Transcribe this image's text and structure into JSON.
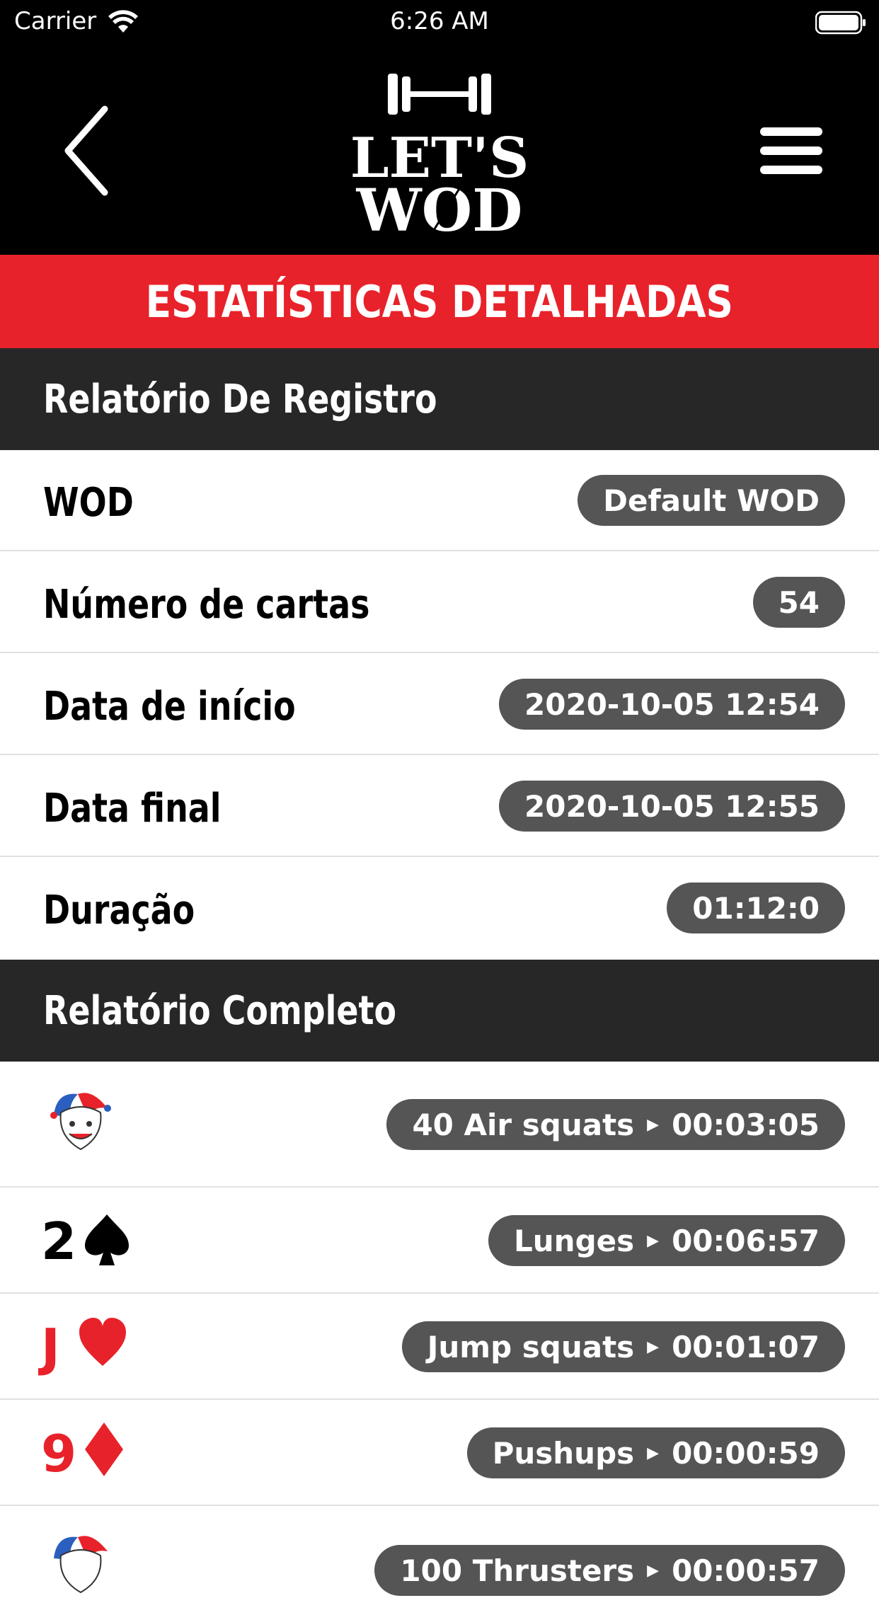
{
  "status_bar": {
    "carrier": "Carrier",
    "time": "6:26 AM"
  },
  "header": {
    "logo_line1": "LET'S",
    "logo_line2": "WOD"
  },
  "page_title": "ESTATÍSTICAS DETALHADAS",
  "registro": {
    "title": "Relatório De Registro",
    "rows": [
      {
        "label": "WOD",
        "value": "Default WOD"
      },
      {
        "label": "Número de cartas",
        "value": "54"
      },
      {
        "label": "Data de início",
        "value": "2020-10-05 12:54"
      },
      {
        "label": "Data final",
        "value": "2020-10-05 12:55"
      },
      {
        "label": "Duração",
        "value": "01:12:0"
      }
    ]
  },
  "completo": {
    "title": "Relatório Completo",
    "cards": [
      {
        "rank": "",
        "suit": "joker-icon",
        "exercise": "40 Air squats",
        "time": "00:03:05"
      },
      {
        "rank": "2",
        "suit": "spade-icon",
        "exercise": "Lunges",
        "time": "00:06:57",
        "color": "#000000"
      },
      {
        "rank": "J",
        "suit": "heart-icon",
        "exercise": "Jump squats",
        "time": "00:01:07",
        "color": "#e8222a"
      },
      {
        "rank": "9",
        "suit": "diamond-icon",
        "exercise": "Pushups",
        "time": "00:00:59",
        "color": "#e8222a"
      },
      {
        "rank": "",
        "suit": "joker-icon",
        "exercise": "100 Thrusters",
        "time": "00:00:57"
      }
    ]
  }
}
